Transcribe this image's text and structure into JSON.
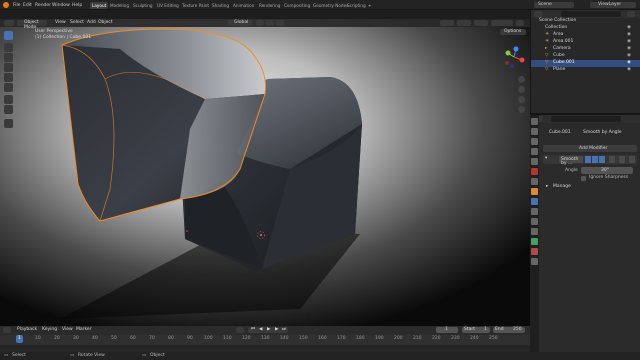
{
  "topbar": {
    "menus": [
      "File",
      "Edit",
      "Render",
      "Window",
      "Help"
    ],
    "workspaces": [
      "Layout",
      "Modeling",
      "Sculpting",
      "UV Editing",
      "Texture Paint",
      "Shading",
      "Animation",
      "Rendering",
      "Compositing",
      "Geometry Nodes",
      "Scripting"
    ],
    "active_workspace": "Layout",
    "scene_label": "Scene",
    "view_layer_label": "ViewLayer"
  },
  "viewport_header": {
    "mode": "Object Mode",
    "menus": [
      "View",
      "Select",
      "Add",
      "Object"
    ],
    "transform": "Global",
    "options": "Options"
  },
  "overlay": {
    "line1": "User Perspective",
    "line2": "(1) Collection | Cube.001"
  },
  "outliner": {
    "root": "Scene Collection",
    "collection": "Collection",
    "items": [
      {
        "name": "Area",
        "selected": false
      },
      {
        "name": "Area.001",
        "selected": false
      },
      {
        "name": "Camera",
        "selected": false
      },
      {
        "name": "Cube",
        "selected": false
      },
      {
        "name": "Cube.001",
        "selected": true
      },
      {
        "name": "Plane",
        "selected": false
      }
    ]
  },
  "properties": {
    "object_name": "Cube.001",
    "modifier_title": "Smooth by Angle",
    "add_modifier": "Add Modifier",
    "modifier_name": "Smooth by ...",
    "angle_label": "Angle",
    "angle_value": "30°",
    "ignore_sharpness": "Ignore Sharpness",
    "manage": "Manage"
  },
  "timeline": {
    "menus": [
      "Playback",
      "Keying",
      "View",
      "Marker"
    ],
    "current_frame": "1",
    "start_label": "Start",
    "start_value": "1",
    "end_label": "End",
    "end_value": "250",
    "ruler": [
      "1",
      "10",
      "20",
      "30",
      "40",
      "50",
      "60",
      "70",
      "80",
      "90",
      "100",
      "110",
      "120",
      "130",
      "140",
      "150",
      "160",
      "170",
      "180",
      "190",
      "200",
      "210",
      "220",
      "230",
      "240",
      "250"
    ]
  },
  "statusbar": {
    "items": [
      "Select",
      "Rotate View",
      "Object"
    ]
  },
  "colors": {
    "accent": "#4772b3",
    "selection_outline": "#f08a24",
    "outliner_selected": "#334d80",
    "axis_x": "#e44",
    "axis_y": "#8c3",
    "axis_z": "#48f"
  }
}
